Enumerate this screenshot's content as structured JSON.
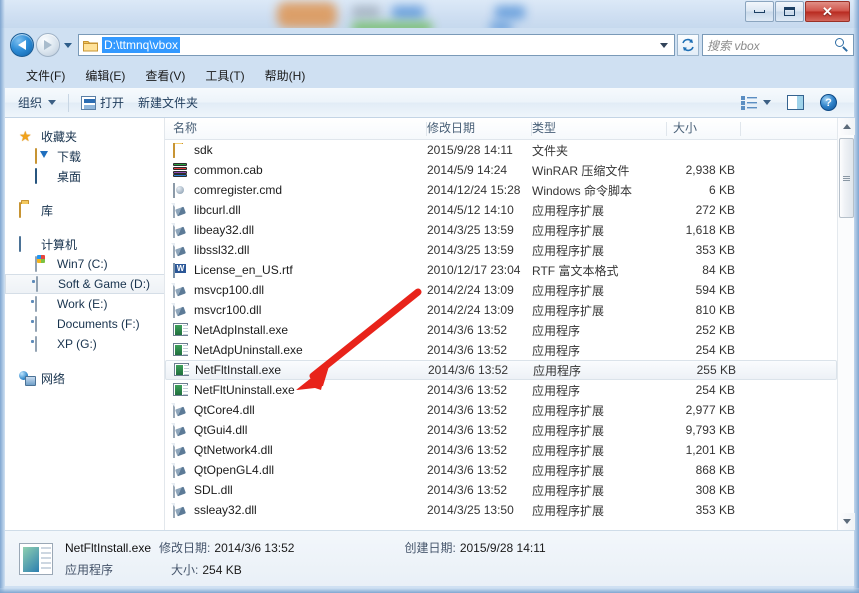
{
  "window": {
    "controls": {
      "minimize": "最小化",
      "maximize": "最大化",
      "close": "✕"
    }
  },
  "nav": {
    "back": "后退",
    "forward": "前进",
    "history_dropdown": "最近访问的位置",
    "address_value": "D:\\ttmnq\\vbox",
    "address_dropdown": "▼",
    "refresh": "↻",
    "search_placeholder": "搜索 vbox"
  },
  "menu": {
    "items": [
      {
        "label": "文件(F)",
        "name": "menu-file"
      },
      {
        "label": "编辑(E)",
        "name": "menu-edit"
      },
      {
        "label": "查看(V)",
        "name": "menu-view"
      },
      {
        "label": "工具(T)",
        "name": "menu-tools"
      },
      {
        "label": "帮助(H)",
        "name": "menu-help"
      }
    ]
  },
  "toolbar": {
    "organize": "组织",
    "open": "打开",
    "new_folder": "新建文件夹",
    "help_glyph": "?"
  },
  "sidebar": {
    "groups": [
      {
        "label": "收藏夹",
        "icon": "star-icon",
        "level": 0
      },
      {
        "label": "下载",
        "icon": "downloads-icon",
        "level": 1
      },
      {
        "label": "桌面",
        "icon": "desktop-icon",
        "level": 1
      },
      {
        "label": "库",
        "icon": "library-icon",
        "level": 0
      },
      {
        "label": "计算机",
        "icon": "computer-icon",
        "level": 0
      },
      {
        "label": "Win7 (C:)",
        "icon": "windows-drive-icon",
        "level": 1
      },
      {
        "label": "Soft & Game (D:)",
        "icon": "drive-icon",
        "level": 1,
        "selected": true
      },
      {
        "label": "Work (E:)",
        "icon": "drive-icon",
        "level": 1
      },
      {
        "label": "Documents (F:)",
        "icon": "drive-icon",
        "level": 1
      },
      {
        "label": "XP (G:)",
        "icon": "drive-icon",
        "level": 1
      },
      {
        "label": "网络",
        "icon": "network-icon",
        "level": 0
      }
    ]
  },
  "filelist": {
    "columns": [
      "名称",
      "修改日期",
      "类型",
      "大小"
    ],
    "rows": [
      {
        "name": "sdk",
        "date": "2015/9/28 14:11",
        "type": "文件夹",
        "size": "",
        "icon": "folder-icon"
      },
      {
        "name": "common.cab",
        "date": "2014/5/9 14:24",
        "type": "WinRAR 压缩文件",
        "size": "2,938 KB",
        "icon": "winrar-archive-icon"
      },
      {
        "name": "comregister.cmd",
        "date": "2014/12/24 15:28",
        "type": "Windows 命令脚本",
        "size": "6 KB",
        "icon": "cmd-script-icon"
      },
      {
        "name": "libcurl.dll",
        "date": "2014/5/12 14:10",
        "type": "应用程序扩展",
        "size": "272 KB",
        "icon": "dll-icon"
      },
      {
        "name": "libeay32.dll",
        "date": "2014/3/25 13:59",
        "type": "应用程序扩展",
        "size": "1,618 KB",
        "icon": "dll-icon"
      },
      {
        "name": "libssl32.dll",
        "date": "2014/3/25 13:59",
        "type": "应用程序扩展",
        "size": "353 KB",
        "icon": "dll-icon"
      },
      {
        "name": "License_en_US.rtf",
        "date": "2010/12/17 23:04",
        "type": "RTF 富文本格式",
        "size": "84 KB",
        "icon": "rtf-document-icon"
      },
      {
        "name": "msvcp100.dll",
        "date": "2014/2/24 13:09",
        "type": "应用程序扩展",
        "size": "594 KB",
        "icon": "dll-icon"
      },
      {
        "name": "msvcr100.dll",
        "date": "2014/2/24 13:09",
        "type": "应用程序扩展",
        "size": "810 KB",
        "icon": "dll-icon"
      },
      {
        "name": "NetAdpInstall.exe",
        "date": "2014/3/6 13:52",
        "type": "应用程序",
        "size": "252 KB",
        "icon": "exe-icon"
      },
      {
        "name": "NetAdpUninstall.exe",
        "date": "2014/3/6 13:52",
        "type": "应用程序",
        "size": "254 KB",
        "icon": "exe-icon"
      },
      {
        "name": "NetFltInstall.exe",
        "date": "2014/3/6 13:52",
        "type": "应用程序",
        "size": "255 KB",
        "icon": "exe-icon",
        "hovered": true
      },
      {
        "name": "NetFltUninstall.exe",
        "date": "2014/3/6 13:52",
        "type": "应用程序",
        "size": "254 KB",
        "icon": "exe-icon"
      },
      {
        "name": "QtCore4.dll",
        "date": "2014/3/6 13:52",
        "type": "应用程序扩展",
        "size": "2,977 KB",
        "icon": "dll-icon"
      },
      {
        "name": "QtGui4.dll",
        "date": "2014/3/6 13:52",
        "type": "应用程序扩展",
        "size": "9,793 KB",
        "icon": "dll-icon"
      },
      {
        "name": "QtNetwork4.dll",
        "date": "2014/3/6 13:52",
        "type": "应用程序扩展",
        "size": "1,201 KB",
        "icon": "dll-icon"
      },
      {
        "name": "QtOpenGL4.dll",
        "date": "2014/3/6 13:52",
        "type": "应用程序扩展",
        "size": "868 KB",
        "icon": "dll-icon"
      },
      {
        "name": "SDL.dll",
        "date": "2014/3/6 13:52",
        "type": "应用程序扩展",
        "size": "308 KB",
        "icon": "dll-icon"
      },
      {
        "name": "ssleay32.dll",
        "date": "2014/3/25 13:50",
        "type": "应用程序扩展",
        "size": "353 KB",
        "icon": "dll-icon"
      }
    ]
  },
  "annotation": {
    "color": "#e8231a",
    "target": "NetFltInstall.exe"
  },
  "statusbar": {
    "file_name": "NetFltInstall.exe",
    "modified_label": "修改日期:",
    "modified_value": "2014/3/6 13:52",
    "created_label": "创建日期:",
    "created_value": "2015/9/28 14:11",
    "file_type": "应用程序",
    "size_label": "大小:",
    "size_value": "254 KB"
  }
}
